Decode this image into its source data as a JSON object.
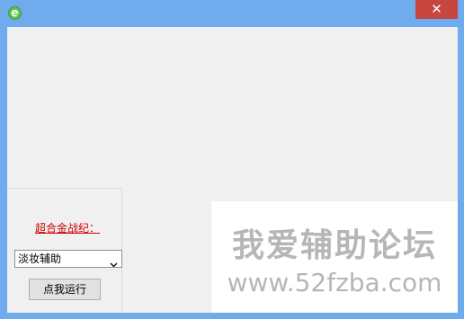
{
  "window": {
    "close_glyph": "✕"
  },
  "icons": {
    "app": "app-e-icon",
    "close": "close-icon",
    "dropdown": "chevron-down-icon"
  },
  "colors": {
    "title_bar": "#6fabed",
    "close_button": "#c7463f",
    "link": "#d00000"
  },
  "main": {
    "link_label": "超合金战纪：",
    "select": {
      "value": "淡妆辅助"
    },
    "run_button_label": "点我运行"
  },
  "watermark": {
    "title": "我爱辅助论坛",
    "url": "www.52fzba.com"
  }
}
